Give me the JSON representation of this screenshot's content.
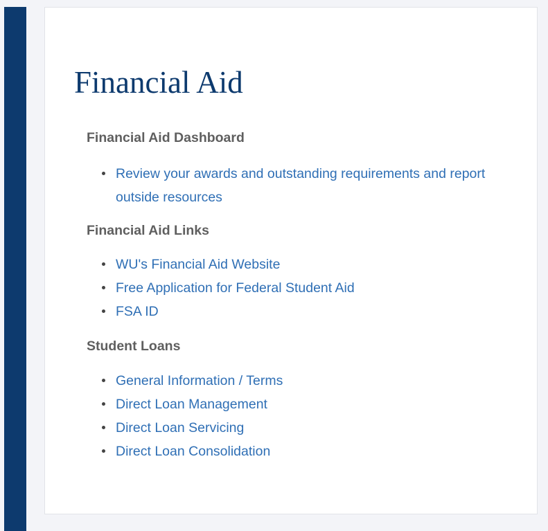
{
  "page": {
    "title": "Financial Aid"
  },
  "sections": [
    {
      "heading": "Financial Aid Dashboard",
      "links": [
        "Review your awards and outstanding requirements and report outside resources"
      ]
    },
    {
      "heading": "Financial Aid Links",
      "links": [
        "WU's Financial Aid Website",
        "Free Application for Federal Student Aid",
        "FSA ID"
      ]
    },
    {
      "heading": "Student Loans",
      "links": [
        "General Information / Terms",
        "Direct Loan Management",
        "Direct Loan Servicing",
        "Direct Loan Consolidation"
      ]
    }
  ],
  "colors": {
    "sidebar_bar": "#0d3a6e",
    "title": "#0d3a6e",
    "heading": "#5f5f5f",
    "link": "#2f6fb5",
    "page_background": "#f3f4f8",
    "card_background": "#ffffff"
  }
}
